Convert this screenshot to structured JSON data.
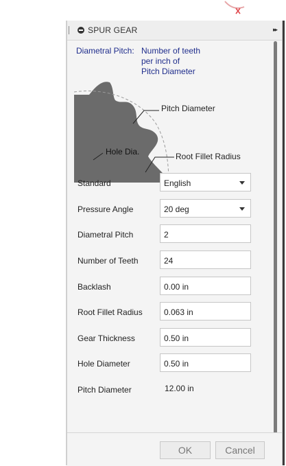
{
  "panel": {
    "title": "SPUR GEAR",
    "expand_icon": "▸▸"
  },
  "info": {
    "label": "Diametral Pitch:",
    "lines": [
      "Number of teeth",
      "per inch of",
      "Pitch Diameter"
    ]
  },
  "diagram": {
    "pitch_diameter": "Pitch Diameter",
    "hole_dia": "Hole Dia.",
    "root_fillet_radius": "Root Fillet Radius"
  },
  "form": {
    "standard": {
      "label": "Standard",
      "value": "English"
    },
    "pressure_angle": {
      "label": "Pressure Angle",
      "value": "20 deg"
    },
    "diametral_pitch": {
      "label": "Diametral Pitch",
      "value": "2"
    },
    "number_of_teeth": {
      "label": "Number of Teeth",
      "value": "24"
    },
    "backlash": {
      "label": "Backlash",
      "value": "0.00 in"
    },
    "root_fillet_radius": {
      "label": "Root Fillet Radius",
      "value": "0.063 in"
    },
    "gear_thickness": {
      "label": "Gear Thickness",
      "value": "0.50 in"
    },
    "hole_diameter": {
      "label": "Hole Diameter",
      "value": "0.50 in"
    },
    "pitch_diameter": {
      "label": "Pitch Diameter",
      "value": "12.00 in"
    }
  },
  "buttons": {
    "ok": "OK",
    "cancel": "Cancel"
  },
  "colors": {
    "info_text": "#1f2d8c",
    "gear_fill": "#6b6b6b",
    "axis_red": "#e0484d"
  }
}
